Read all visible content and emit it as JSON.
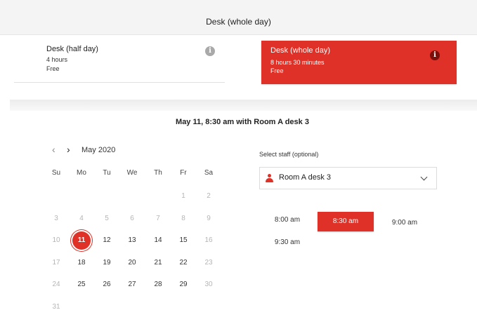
{
  "header": {
    "title": "Desk (whole day)"
  },
  "services": [
    {
      "name": "Desk (half day)",
      "duration": "4 hours",
      "price": "Free",
      "selected": false
    },
    {
      "name": "Desk (whole day)",
      "duration": "8 hours 30 minutes",
      "price": "Free",
      "selected": true
    }
  ],
  "info_glyph": "i",
  "booking": {
    "summary": "May 11, 8:30 am with Room A desk 3"
  },
  "calendar": {
    "prev_label": "‹",
    "next_label": "›",
    "month_label": "May 2020",
    "weekdays": [
      "Su",
      "Mo",
      "Tu",
      "We",
      "Th",
      "Fr",
      "Sa"
    ],
    "weeks": [
      [
        null,
        null,
        null,
        null,
        null,
        "1",
        "2"
      ],
      [
        "3",
        "4",
        "5",
        "6",
        "7",
        "8",
        "9"
      ],
      [
        "10",
        "11",
        "12",
        "13",
        "14",
        "15",
        "16"
      ],
      [
        "17",
        "18",
        "19",
        "20",
        "21",
        "22",
        "23"
      ],
      [
        "24",
        "25",
        "26",
        "27",
        "28",
        "29",
        "30"
      ],
      [
        "31",
        null,
        null,
        null,
        null,
        null,
        null
      ]
    ],
    "available_days": [
      "11",
      "12",
      "13",
      "14",
      "15",
      "18",
      "19",
      "20",
      "21",
      "22",
      "25",
      "26",
      "27",
      "28",
      "29"
    ],
    "selected_day": "11"
  },
  "staff": {
    "label": "Select staff (optional)",
    "value": "Room A desk 3"
  },
  "times": {
    "slots": [
      "8:00 am",
      "8:30 am",
      "9:00 am",
      "9:30 am"
    ],
    "selected": "8:30 am"
  },
  "colors": {
    "accent": "#e03128",
    "muted_text": "#b5b5b5"
  }
}
